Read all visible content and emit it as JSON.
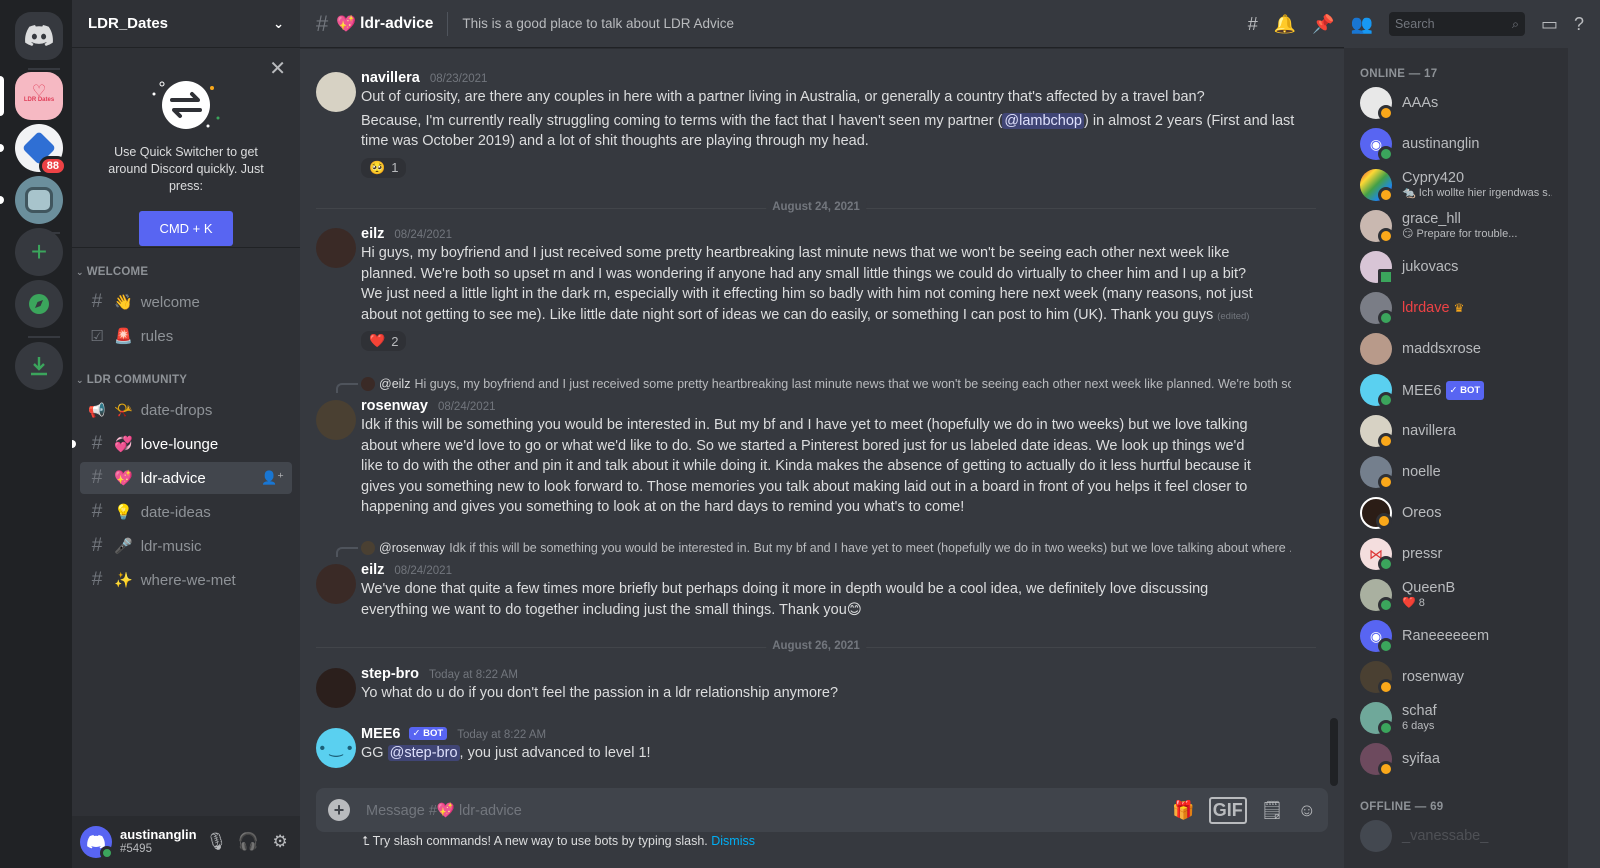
{
  "server": {
    "name": "LDR_Dates",
    "badge_count": "88",
    "icon_text": "LDR Dates"
  },
  "quick_switcher": {
    "tip": "Use Quick Switcher to get around Discord quickly. Just press:",
    "shortcut": "CMD + K"
  },
  "categories": [
    {
      "name": "WELCOME"
    },
    {
      "name": "LDR COMMUNITY"
    }
  ],
  "channels": {
    "welcome": {
      "emoji": "👋",
      "name": "welcome"
    },
    "rules": {
      "emoji": "🚨",
      "name": "rules"
    },
    "date_drops": {
      "emoji": "📯",
      "name": "date-drops"
    },
    "love_lounge": {
      "emoji": "💞",
      "name": "love-lounge"
    },
    "ldr_advice": {
      "emoji": "💖",
      "name": "ldr-advice"
    },
    "date_ideas": {
      "emoji": "💡",
      "name": "date-ideas"
    },
    "ldr_music": {
      "emoji": "🎤",
      "name": "ldr-music"
    },
    "where_we_met": {
      "emoji": "✨",
      "name": "where-we-met"
    }
  },
  "user": {
    "name": "austinanglin",
    "discriminator": "#5495"
  },
  "header": {
    "channel_emoji": "💖",
    "channel_name": "ldr-advice",
    "topic": "This is a good place to talk about LDR Advice",
    "search_placeholder": "Search"
  },
  "day_separators": [
    "August 24, 2021",
    "August 26, 2021"
  ],
  "messages": [
    {
      "author": "navillera",
      "timestamp": "08/23/2021",
      "line1": "Out of curiosity, are there any couples in here with a partner living in Australia, or generally a country that's affected by a travel ban?",
      "line2_pre": "Because, I'm currently really struggling coming to terms with the fact that I haven't seen my partner (",
      "mention": "@lambchop",
      "line2_post": ") in almost 2 years (First and last time was October 2019) and a lot of shit thoughts are playing through my head.",
      "reaction_emoji": "🥺",
      "reaction_count": "1"
    },
    {
      "author": "eilz",
      "timestamp": "08/24/2021",
      "text": "Hi guys, my boyfriend and I just received some pretty heartbreaking last minute news that we won't be seeing each other next week like planned. We're both so upset rn and I was wondering if anyone had any small little things we could do virtually to cheer him and I up a bit? We just need a little light in the dark rn, especially with it effecting him so badly with him not coming here next week (many reasons, not just about not getting to see me).  Like little date night sort of ideas we can do easily, or something I can post to him (UK).  Thank you guys",
      "edited": "(edited)",
      "reaction_emoji": "❤️",
      "reaction_count": "2"
    },
    {
      "reply_name": "@eilz",
      "reply_text": "Hi guys, my boyfriend and I just received some pretty heartbreaking last minute news that we won't be seeing each other next week like planned.  We're both so...",
      "author": "rosenway",
      "timestamp": "08/24/2021",
      "text": "Idk if this will be something you would be interested in. But my bf and I have yet to meet (hopefully we do in two weeks) but we love talking about where we'd love to go or what we'd like to do. So we started a Pinterest bored just for us labeled date ideas. We look up things we'd like to do with the other and pin it and talk about it while doing it. Kinda makes the absence of getting to actually do it less hurtful because it gives you something new to look forward to. Those memories you talk about making laid out in a board in front of you helps it feel closer to happening and gives you something to look at on the hard days to remind you what's to come!"
    },
    {
      "reply_name": "@rosenway",
      "reply_text": "Idk if this will be something you would be interested in. But my bf and I have yet to meet (hopefully we do in two weeks) but we love talking about where ...",
      "author": "eilz",
      "timestamp": "08/24/2021",
      "text": "We've done that quite a few times more briefly but perhaps doing it more in depth would be a cool idea, we definitely love discussing everything we want to do together including just the small things.  Thank you😊"
    },
    {
      "author": "step-bro",
      "timestamp": "Today at 8:22 AM",
      "text": "Yo what do u do if you don't feel the passion in a ldr relationship anymore?"
    },
    {
      "author": "MEE6",
      "bot_label": "✓ BOT",
      "timestamp": "Today at 8:22 AM",
      "text_pre": "GG ",
      "mention": "@step-bro",
      "text_post": ", you just advanced to level 1!"
    }
  ],
  "composer": {
    "placeholder": "Message #💖 ldr-advice",
    "gif_label": "GIF"
  },
  "slash_tip": {
    "text": "Try slash commands! A new way to use bots by typing slash.",
    "dismiss": "Dismiss"
  },
  "members": {
    "online_header": "ONLINE — 17",
    "offline_header": "OFFLINE — 69",
    "online": [
      {
        "name": "AAAs",
        "activity": ""
      },
      {
        "name": "austinanglin",
        "activity": ""
      },
      {
        "name": "Cypry420",
        "activity": "🐀 Ich wollte hier irgendwas s..."
      },
      {
        "name": "grace_hll",
        "activity": "😏 Prepare for trouble..."
      },
      {
        "name": "jukovacs",
        "activity": ""
      },
      {
        "name": "ldrdave",
        "activity": ""
      },
      {
        "name": "maddsxrose",
        "activity": ""
      },
      {
        "name": "MEE6",
        "activity": "",
        "bot_label": "✓ BOT"
      },
      {
        "name": "navillera",
        "activity": ""
      },
      {
        "name": "noelle",
        "activity": ""
      },
      {
        "name": "Oreos",
        "activity": ""
      },
      {
        "name": "pressr",
        "activity": ""
      },
      {
        "name": "QueenB",
        "activity": "❤️ 8"
      },
      {
        "name": "Raneeeeeem",
        "activity": ""
      },
      {
        "name": "rosenway",
        "activity": ""
      },
      {
        "name": "schaf",
        "activity": "6 days"
      },
      {
        "name": "syifaa",
        "activity": ""
      }
    ],
    "offline": [
      {
        "name": "_vanessabe_"
      }
    ]
  },
  "colors": {
    "blurple": "#5865f2",
    "online": "#3ba55c",
    "idle": "#faa81a",
    "owner_red": "#ed4245"
  }
}
